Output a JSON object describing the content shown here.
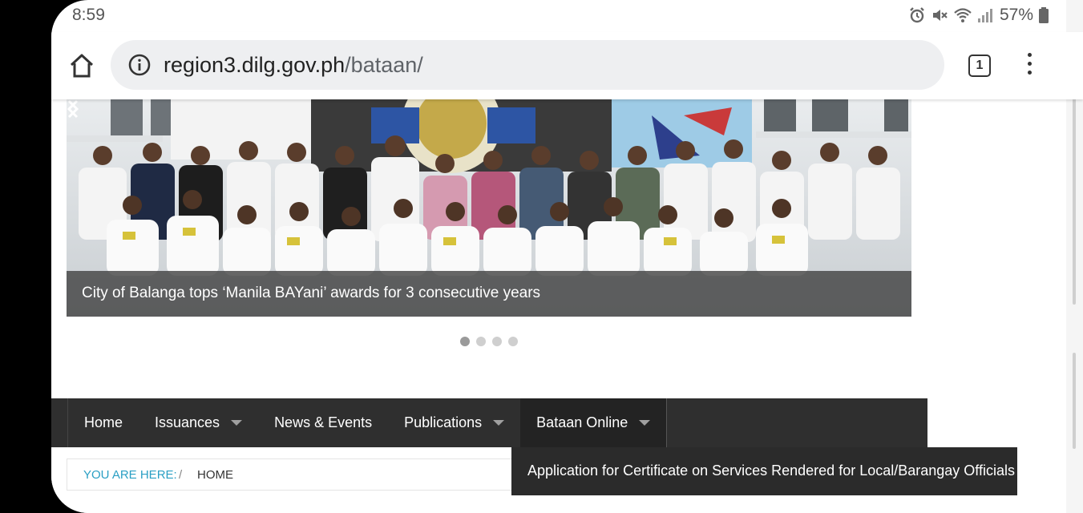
{
  "status_bar": {
    "time": "8:59",
    "battery": "57%",
    "icons": [
      "alarm-icon",
      "mute-icon",
      "wifi-icon",
      "signal-icon",
      "battery-icon"
    ]
  },
  "browser": {
    "url_host": "region3.dilg.gov.ph",
    "url_path": "/bataan/",
    "tab_count": "1"
  },
  "slider": {
    "caption": "City of Balanga tops ‘Manila BAYani’ awards for 3 consecutive years",
    "slide_count": 4,
    "active_slide": 1
  },
  "nav": {
    "items": [
      {
        "label": "Home",
        "has_dropdown": false
      },
      {
        "label": "Issuances",
        "has_dropdown": true
      },
      {
        "label": "News & Events",
        "has_dropdown": false
      },
      {
        "label": "Publications",
        "has_dropdown": true
      },
      {
        "label": "Bataan Online",
        "has_dropdown": true
      }
    ],
    "dropdown_item": "Application for Certificate on Services Rendered for Local/Barangay Officials"
  },
  "breadcrumb": {
    "label": "YOU ARE HERE:",
    "separator": "/",
    "current": "HOME"
  },
  "colors": {
    "nav_bg": "#2f2f2f",
    "breadcrumb_label": "#2a9fc4",
    "url_bar_bg": "#eeeff1"
  }
}
